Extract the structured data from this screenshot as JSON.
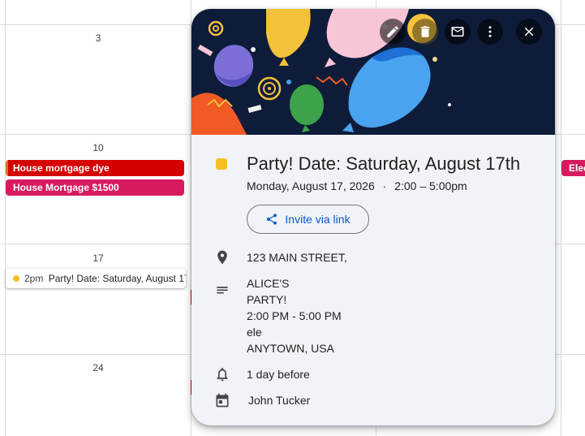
{
  "calendar": {
    "day_numbers": [
      "3",
      "10",
      "17",
      "24"
    ],
    "events": [
      {
        "label": "House mortgage dye",
        "color": "#d50000"
      },
      {
        "label": "House Mortgage $1500",
        "color": "#d81b60"
      }
    ],
    "right_event_label": "Elec",
    "hover_event": {
      "time": "2pm",
      "title": "Party! Date: Saturday, August 17th"
    }
  },
  "popover": {
    "toolbar": {
      "edit": "edit-icon",
      "delete": "trash-icon",
      "email": "mail-icon",
      "more": "more-vert-icon",
      "close": "close-icon"
    },
    "color": "#f6bf26",
    "title": "Party! Date: Saturday, August 17th",
    "date": "Monday, August 17, 2026",
    "separator": "·",
    "time": "2:00 – 5:00pm",
    "invite_label": "Invite via link",
    "location": "123 MAIN STREET,",
    "description": [
      "ALICE'S",
      "PARTY!",
      "2:00 PM - 5:00 PM",
      "ele",
      "ANYTOWN, USA"
    ],
    "reminder": "1 day before",
    "organizer": "John Tucker"
  }
}
